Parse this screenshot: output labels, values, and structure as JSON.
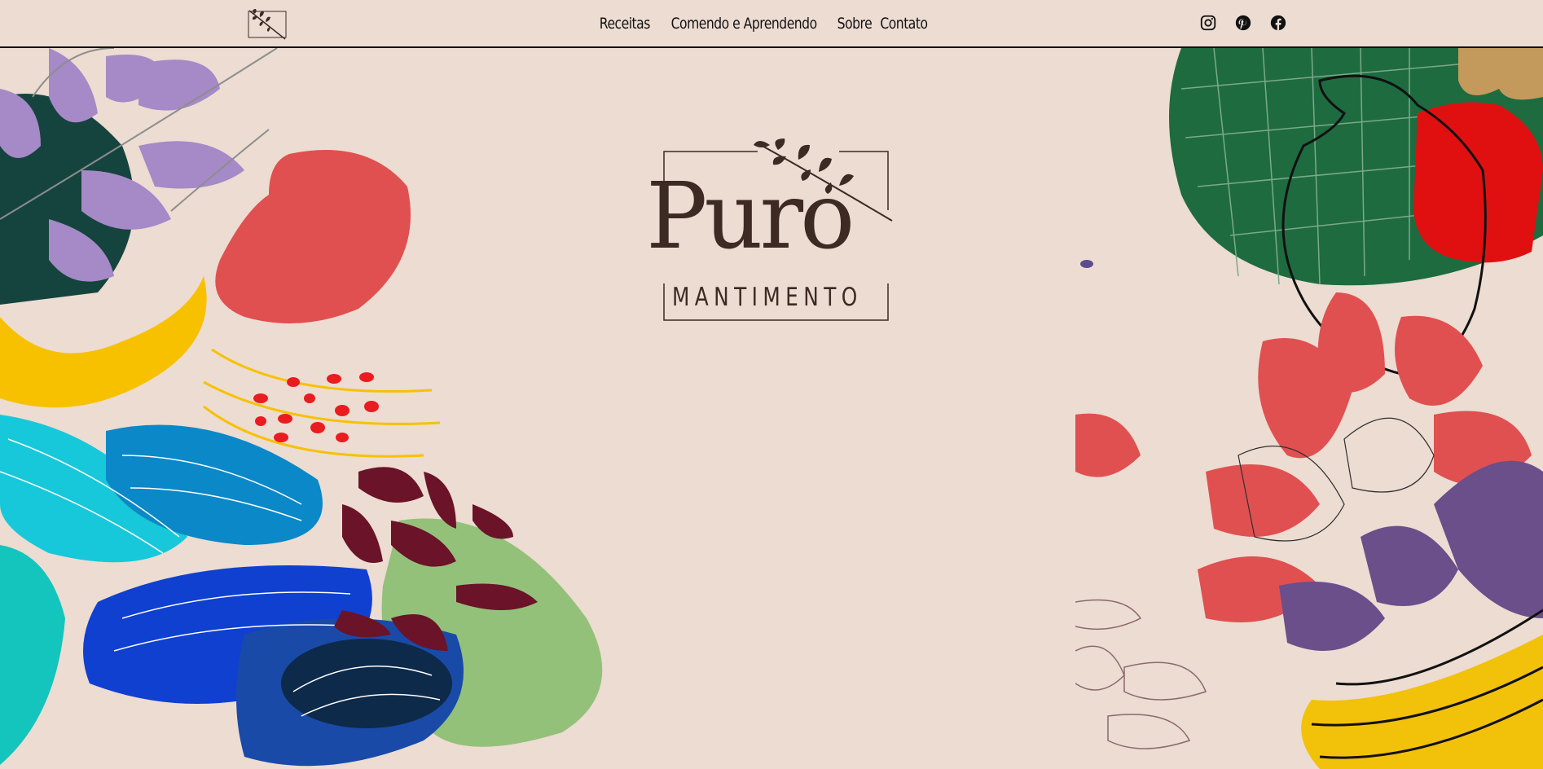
{
  "header": {
    "logo_icon": "olive-branch-icon",
    "nav": [
      {
        "label": "Receitas"
      },
      {
        "label": "Comendo e Aprendendo"
      },
      {
        "label": "Sobre"
      },
      {
        "label": "Contato"
      }
    ],
    "social": [
      {
        "icon": "instagram-icon"
      },
      {
        "icon": "pinterest-icon"
      },
      {
        "icon": "facebook-icon"
      }
    ]
  },
  "hero": {
    "brand_name": "Puro",
    "brand_subtitle": "MANTIMENTO"
  },
  "colors": {
    "background": "#ecdcd2",
    "brand": "#3d2a22",
    "accent_red": "#e05050",
    "accent_yellow": "#f7c100",
    "accent_blue": "#1040d0",
    "accent_green": "#1e6b40"
  }
}
